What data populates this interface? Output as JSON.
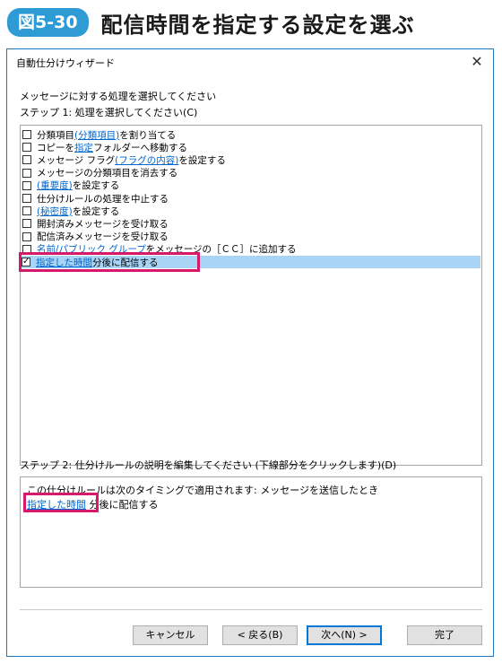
{
  "figure": {
    "badge": "図5-30",
    "title": "配信時間を指定する設定を選ぶ"
  },
  "window": {
    "title": "自動仕分けウィザード",
    "close_glyph": "✕"
  },
  "instructions": {
    "line1": "メッセージに対する処理を選択してください",
    "step1": "ステップ 1: 処理を選択してください(C)"
  },
  "actions": [
    {
      "checked": false,
      "parts": [
        {
          "t": "分類項目 "
        },
        {
          "t": "(分類項目)",
          "link": true
        },
        {
          "t": " を割り当てる"
        }
      ]
    },
    {
      "checked": false,
      "parts": [
        {
          "t": "コピーを "
        },
        {
          "t": "指定",
          "link": true
        },
        {
          "t": " フォルダーへ移動する"
        }
      ]
    },
    {
      "checked": false,
      "parts": [
        {
          "t": "メッセージ フラグ "
        },
        {
          "t": "(フラグの内容)",
          "link": true
        },
        {
          "t": " を設定する"
        }
      ]
    },
    {
      "checked": false,
      "parts": [
        {
          "t": "メッセージの分類項目を消去する"
        }
      ]
    },
    {
      "checked": false,
      "parts": [
        {
          "t": "(重要度)",
          "link": true
        },
        {
          "t": " を設定する"
        }
      ]
    },
    {
      "checked": false,
      "parts": [
        {
          "t": "仕分けルールの処理を中止する"
        }
      ]
    },
    {
      "checked": false,
      "parts": [
        {
          "t": "(秘密度)",
          "link": true
        },
        {
          "t": " を設定する"
        }
      ]
    },
    {
      "checked": false,
      "parts": [
        {
          "t": "開封済みメッセージを受け取る"
        }
      ]
    },
    {
      "checked": false,
      "parts": [
        {
          "t": "配信済みメッセージを受け取る"
        }
      ]
    },
    {
      "checked": false,
      "parts": [
        {
          "t": "名前/パブリック グループ",
          "link": true
        },
        {
          "t": " をメッセージの［ＣＣ］に追加する"
        }
      ]
    },
    {
      "checked": true,
      "selected": true,
      "parts": [
        {
          "t": "指定した時間",
          "link": true
        },
        {
          "t": " 分後に配信する"
        }
      ]
    }
  ],
  "step2": {
    "label": "ステップ 2: 仕分けルールの説明を編集してください (下線部分をクリックします)(D)",
    "line1": "この仕分けルールは次のタイミングで適用されます: メッセージを送信したとき",
    "line2_link": "指定した時間",
    "line2_rest": " 分後に配信する"
  },
  "buttons": {
    "cancel": "キャンセル",
    "back": "< 戻る(B)",
    "next": "次へ(N) >",
    "finish": "完了"
  },
  "colors": {
    "accent": "#2f9bd5",
    "highlight": "#d6196b",
    "selection": "#a9d4f5",
    "link": "#0066cc"
  }
}
